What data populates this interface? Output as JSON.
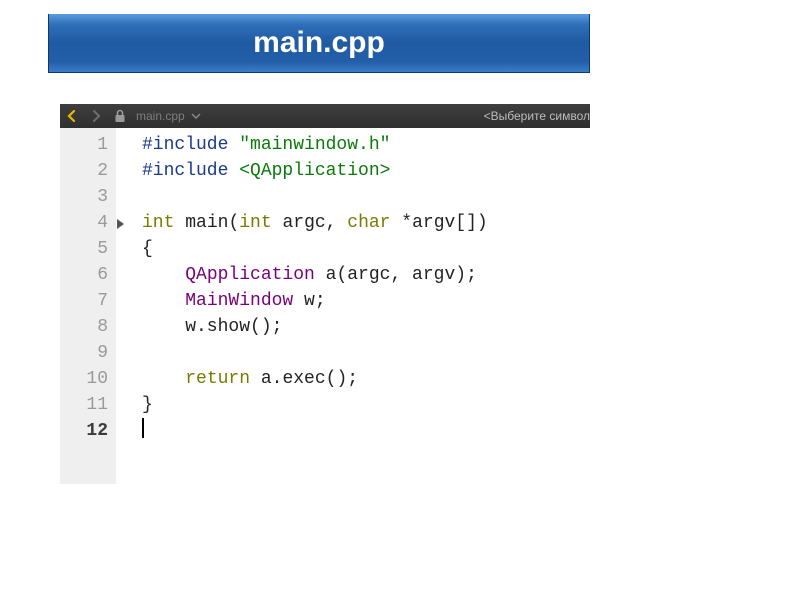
{
  "banner": {
    "title": "main.cpp"
  },
  "toolbar": {
    "nav_back_icon": "arrow-left",
    "nav_fwd_icon": "arrow-right",
    "lock_icon": "lock",
    "file_label": "main.cpp",
    "dropdown_icon": "chevron-down",
    "symbol_placeholder": "<Выберите символ"
  },
  "code": {
    "lines": [
      {
        "n": "1",
        "segs": [
          {
            "t": "#include ",
            "c": "tok-pp"
          },
          {
            "t": "\"mainwindow.h\"",
            "c": "tok-str"
          }
        ]
      },
      {
        "n": "2",
        "segs": [
          {
            "t": "#include ",
            "c": "tok-pp"
          },
          {
            "t": "<QApplication>",
            "c": "tok-str"
          }
        ]
      },
      {
        "n": "3",
        "segs": []
      },
      {
        "n": "4",
        "fold": true,
        "segs": [
          {
            "t": "int ",
            "c": "tok-kw"
          },
          {
            "t": "main",
            "c": ""
          },
          {
            "t": "(",
            "c": ""
          },
          {
            "t": "int ",
            "c": "tok-kw"
          },
          {
            "t": "argc, ",
            "c": ""
          },
          {
            "t": "char ",
            "c": "tok-kw"
          },
          {
            "t": "*argv[])",
            "c": ""
          }
        ]
      },
      {
        "n": "5",
        "segs": [
          {
            "t": "{",
            "c": ""
          }
        ]
      },
      {
        "n": "6",
        "segs": [
          {
            "t": "    ",
            "c": ""
          },
          {
            "t": "QApplication",
            "c": "tok-type"
          },
          {
            "t": " a(argc, argv);",
            "c": ""
          }
        ]
      },
      {
        "n": "7",
        "segs": [
          {
            "t": "    ",
            "c": ""
          },
          {
            "t": "MainWindow",
            "c": "tok-type"
          },
          {
            "t": " w;",
            "c": ""
          }
        ]
      },
      {
        "n": "8",
        "segs": [
          {
            "t": "    w.show();",
            "c": ""
          }
        ]
      },
      {
        "n": "9",
        "segs": []
      },
      {
        "n": "10",
        "segs": [
          {
            "t": "    ",
            "c": ""
          },
          {
            "t": "return ",
            "c": "tok-kw"
          },
          {
            "t": "a.exec();",
            "c": ""
          }
        ]
      },
      {
        "n": "11",
        "segs": [
          {
            "t": "}",
            "c": ""
          }
        ]
      },
      {
        "n": "12",
        "current": true,
        "cursor": true,
        "segs": []
      }
    ]
  }
}
